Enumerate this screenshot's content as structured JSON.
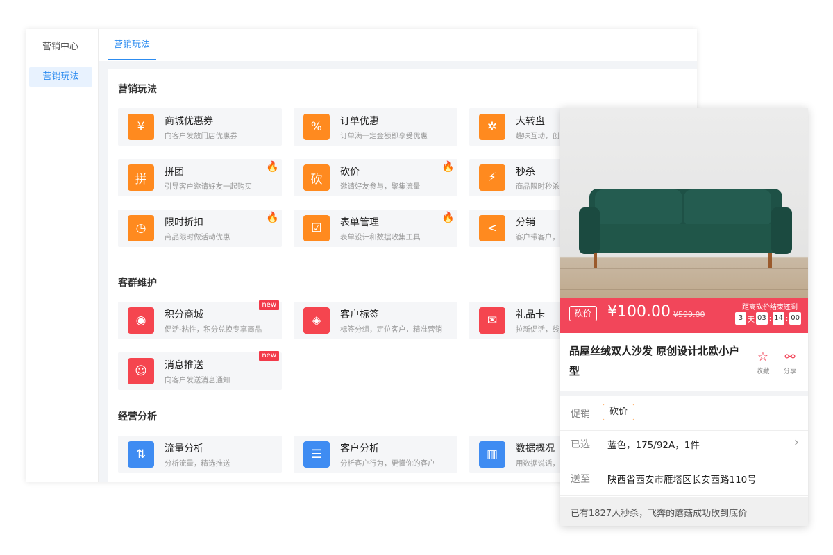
{
  "sidebar": {
    "title": "营销中心",
    "active_item": "营销玩法"
  },
  "topbar": {
    "tab": "营销玩法"
  },
  "sections": [
    {
      "title": "营销玩法",
      "cards": [
        {
          "name": "商城优惠券",
          "desc": "向客户发放门店优惠券",
          "icon": "coupon-icon",
          "glyph": "¥",
          "color": "orange"
        },
        {
          "name": "订单优惠",
          "desc": "订单满一定金额即享受优惠",
          "icon": "percent-icon",
          "glyph": "%",
          "color": "orange"
        },
        {
          "name": "大转盘",
          "desc": "趣味互动，创",
          "icon": "wheel-icon",
          "glyph": "✲",
          "color": "orange"
        },
        {
          "name": "拼团",
          "desc": "引导客户邀请好友一起购买",
          "icon": "group-icon",
          "glyph": "拼",
          "color": "orange",
          "hot": true
        },
        {
          "name": "砍价",
          "desc": "邀请好友参与，聚集流量",
          "icon": "bargain-icon",
          "glyph": "砍",
          "color": "orange",
          "hot": true
        },
        {
          "name": "秒杀",
          "desc": "商品限时秒杀",
          "icon": "flash-icon",
          "glyph": "⚡",
          "color": "orange"
        },
        {
          "name": "限时折扣",
          "desc": "商品限时做活动优惠",
          "icon": "clock-icon",
          "glyph": "◷",
          "color": "orange",
          "hot": true
        },
        {
          "name": "表单管理",
          "desc": "表单设计和数据收集工具",
          "icon": "form-icon",
          "glyph": "☑",
          "color": "orange",
          "hot": true
        },
        {
          "name": "分销",
          "desc": "客户带客户，",
          "icon": "share-icon",
          "glyph": "<",
          "color": "orange"
        }
      ]
    },
    {
      "title": "客群维护",
      "cards": [
        {
          "name": "积分商城",
          "desc": "促活-粘性，积分兑换专享商品",
          "icon": "coins-icon",
          "glyph": "◉",
          "color": "red",
          "new": "new"
        },
        {
          "name": "客户标签",
          "desc": "标签分组，定位客户，精准营销",
          "icon": "tag-icon",
          "glyph": "◈",
          "color": "red"
        },
        {
          "name": "礼品卡",
          "desc": "拉新促活，线",
          "icon": "giftcard-icon",
          "glyph": "✉",
          "color": "red"
        },
        {
          "name": "消息推送",
          "desc": "向客户发送消息通知",
          "icon": "message-icon",
          "glyph": "☺",
          "color": "red",
          "new": "new"
        }
      ]
    },
    {
      "title": "经营分析",
      "cards": [
        {
          "name": "流量分析",
          "desc": "分析流量，精选推送",
          "icon": "traffic-icon",
          "glyph": "⇅",
          "color": "blue"
        },
        {
          "name": "客户分析",
          "desc": "分析客户行为，更懂你的客户",
          "icon": "customer-icon",
          "glyph": "☰",
          "color": "blue"
        },
        {
          "name": "数据概况",
          "desc": "用数据说话，",
          "icon": "chart-icon",
          "glyph": "▥",
          "color": "blue"
        }
      ]
    }
  ],
  "product": {
    "tag": "砍价",
    "price": "¥100.00",
    "old_price": "¥599.00",
    "countdown_label": "距离砍价结束还剩",
    "countdown": {
      "days": "3",
      "day_unit": "天",
      "hours": "03",
      "minutes": "14",
      "seconds": "00"
    },
    "title": "品屋丝绒双人沙发 原创设计北欧小户型",
    "collect_label": "收藏",
    "share_label": "分享",
    "promo_label": "促销",
    "promo_value": "砍价",
    "selected_label": "已选",
    "selected_value": "蓝色，175/92A，1件",
    "ship_label": "送至",
    "ship_value": "陕西省西安市雁塔区长安西路110号",
    "footer": "已有1827人秒杀，飞奔的蘑菇成功砍到底价"
  }
}
